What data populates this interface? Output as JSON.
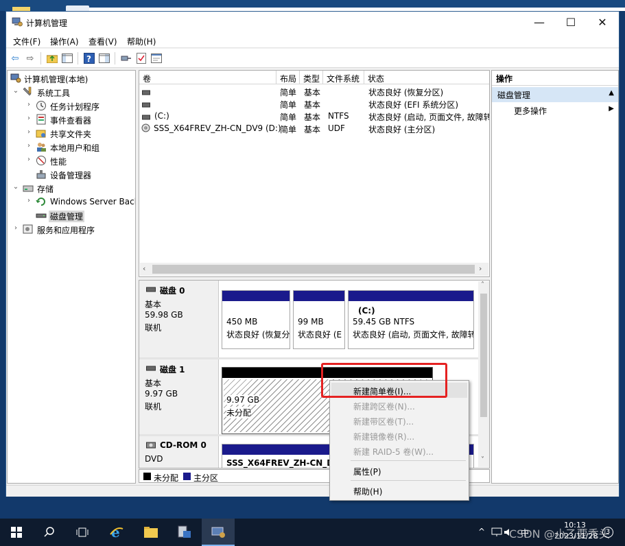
{
  "window": {
    "title": "计算机管理"
  },
  "menu": [
    "文件(F)",
    "操作(A)",
    "查看(V)",
    "帮助(H)"
  ],
  "tree": [
    {
      "label": "计算机管理(本地)"
    },
    {
      "label": "系统工具"
    },
    {
      "label": "任务计划程序"
    },
    {
      "label": "事件查看器"
    },
    {
      "label": "共享文件夹"
    },
    {
      "label": "本地用户和组"
    },
    {
      "label": "性能"
    },
    {
      "label": "设备管理器"
    },
    {
      "label": "存储"
    },
    {
      "label": "Windows Server Back"
    },
    {
      "label": "磁盘管理"
    },
    {
      "label": "服务和应用程序"
    }
  ],
  "volumes": {
    "headers": [
      "卷",
      "布局",
      "类型",
      "文件系统",
      "状态"
    ],
    "rows": [
      {
        "name": "",
        "layout": "简单",
        "type": "基本",
        "fs": "",
        "status": "状态良好 (恢复分区)"
      },
      {
        "name": "",
        "layout": "简单",
        "type": "基本",
        "fs": "",
        "status": "状态良好 (EFI 系统分区)"
      },
      {
        "name": "(C:)",
        "layout": "简单",
        "type": "基本",
        "fs": "NTFS",
        "status": "状态良好 (启动, 页面文件, 故障转"
      },
      {
        "name": "SSS_X64FREV_ZH-CN_DV9 (D:)",
        "layout": "简单",
        "type": "基本",
        "fs": "UDF",
        "status": "状态良好 (主分区)"
      }
    ]
  },
  "disks": {
    "disk0": {
      "name": "磁盘 0",
      "kind": "基本",
      "size": "59.98 GB",
      "state": "联机",
      "p1": {
        "size": "450 MB",
        "status": "状态良好 (恢复分"
      },
      "p2": {
        "size": "99 MB",
        "status": "状态良好 (E"
      },
      "p3": {
        "title": "(C:)",
        "size": "59.45 GB NTFS",
        "status": "状态良好 (启动, 页面文件, 故障转"
      }
    },
    "disk1": {
      "name": "磁盘 1",
      "kind": "基本",
      "size": "9.97 GB",
      "state": "联机",
      "p1": {
        "size": "9.97 GB",
        "status": "未分配"
      }
    },
    "cdrom": {
      "name": "CD-ROM 0",
      "kind": "DVD",
      "p1": {
        "title": "SSS_X64FREV_ZH-CN_DVS"
      }
    }
  },
  "legend": {
    "unallocated": "未分配",
    "primary": "主分区"
  },
  "actions": {
    "title": "操作",
    "group": "磁盘管理",
    "more": "更多操作"
  },
  "context_menu": [
    {
      "label": "新建简单卷(I)...",
      "enabled": true
    },
    {
      "label": "新建跨区卷(N)...",
      "enabled": false
    },
    {
      "label": "新建带区卷(T)...",
      "enabled": false
    },
    {
      "label": "新建镜像卷(R)...",
      "enabled": false
    },
    {
      "label": "新建 RAID-5 卷(W)...",
      "enabled": false
    },
    {
      "label": "属性(P)",
      "enabled": true
    },
    {
      "label": "帮助(H)",
      "enabled": true
    }
  ],
  "taskbar": {
    "ime": "中",
    "time": "10:13",
    "date": "2023/11/28",
    "watermark": "CSDN @小乙要秃头",
    "notification_count": "3"
  },
  "colors": {
    "partition_blue": "#1a1a8c",
    "unallocated_black": "#000000",
    "highlight_red": "#e52222",
    "taskbar_bg": "#0e1b2e"
  }
}
